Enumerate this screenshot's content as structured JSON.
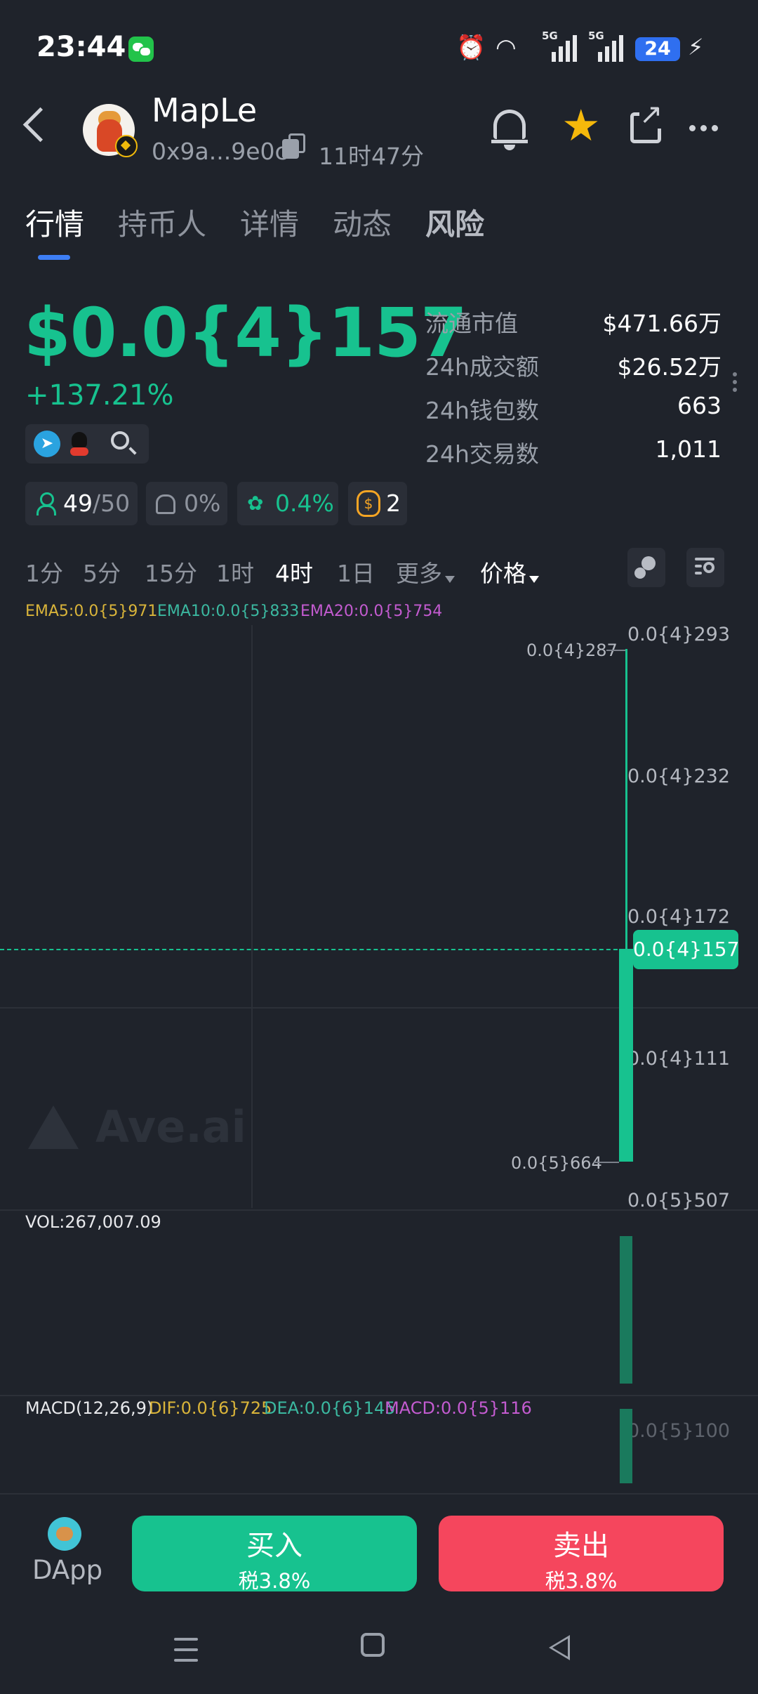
{
  "status_bar": {
    "time": "23:44",
    "battery": "24",
    "net1": "5G",
    "net2": "5G"
  },
  "header": {
    "token_name": "MapLe",
    "address": "0x9a...9e0c",
    "age": "11时47分"
  },
  "tabs": [
    "行情",
    "持币人",
    "详情",
    "动态",
    "风险"
  ],
  "price": {
    "value": "$0.0{4}157",
    "change": "+137.21%"
  },
  "stats": [
    {
      "label": "流通市值",
      "value": "$471.66万"
    },
    {
      "label": "24h成交额",
      "value": "$26.52万"
    },
    {
      "label": "24h钱包数",
      "value": "663"
    },
    {
      "label": "24h交易数",
      "value": "1,011"
    }
  ],
  "badges": {
    "holders": "49",
    "holders_total": "/50",
    "dev": "0%",
    "bundle": "0.4%",
    "snipers": "2"
  },
  "timeframes": [
    "1分",
    "5分",
    "15分",
    "1时",
    "4时",
    "1日",
    "更多",
    "价格"
  ],
  "ema": {
    "ema5": "EMA5:0.0{5}971",
    "ema10": "EMA10:0.0{5}833",
    "ema20": "EMA20:0.0{5}754"
  },
  "chart_data": {
    "type": "candlestick",
    "interval": "4时",
    "y_axis_labels": [
      "0.0{4}293",
      "0.0{4}232",
      "0.0{4}172",
      "0.0{4}111",
      "0.0{5}507"
    ],
    "current_price_tag": "0.0{4}157",
    "high_annotation": "0.0{4}287",
    "low_annotation": "0.0{5}664",
    "candles": [
      {
        "open": "0.0{5}664",
        "high": "0.0{4}287",
        "low": "0.0{5}664",
        "close": "0.0{4}157"
      }
    ],
    "volume": "VOL:267,007.09",
    "macd": {
      "label": "MACD(12,26,9)",
      "dif": "DIF:0.0{6}725",
      "dea": "DEA:0.0{6}145",
      "macd": "MACD:0.0{5}116",
      "axis": "0.0{5}100"
    },
    "colors": {
      "up": "#17c28f",
      "down": "#f5465d",
      "ema5": "#d9b43a",
      "ema10": "#3bb8a0",
      "ema20": "#c35bd0"
    }
  },
  "watermark": "Ave.ai",
  "bottom": {
    "dapp": "DApp",
    "buy": "买入",
    "buy_tax": "税3.8%",
    "sell": "卖出",
    "sell_tax": "税3.8%"
  }
}
